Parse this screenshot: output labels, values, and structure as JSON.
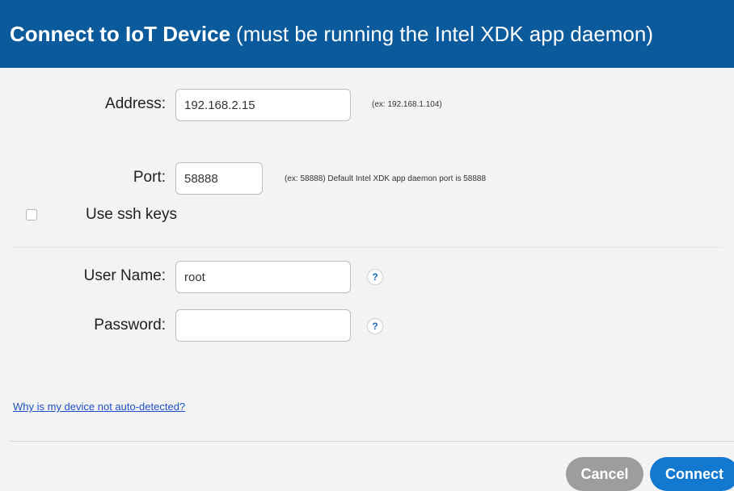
{
  "header": {
    "title_bold": "Connect to IoT Device",
    "title_rest": "(must be running the Intel XDK app daemon)"
  },
  "form": {
    "address": {
      "label": "Address:",
      "value": "192.168.2.15",
      "hint": "(ex: 192.168.1.104)"
    },
    "port": {
      "label": "Port:",
      "value": "58888",
      "hint": "(ex: 58888) Default Intel XDK app daemon port is 58888"
    },
    "ssh_keys": {
      "label": "Use ssh keys",
      "checked": false
    },
    "username": {
      "label": "User Name:",
      "value": "root",
      "help": "?"
    },
    "password": {
      "label": "Password:",
      "value": "",
      "help": "?"
    }
  },
  "help_link": "Why is my device not auto-detected?",
  "buttons": {
    "cancel": "Cancel",
    "connect": "Connect"
  },
  "colors": {
    "header_bg": "#0a5a9c",
    "connect_button": "#1378cf",
    "cancel_button": "#9d9d9d",
    "link": "#1f4fc7"
  }
}
